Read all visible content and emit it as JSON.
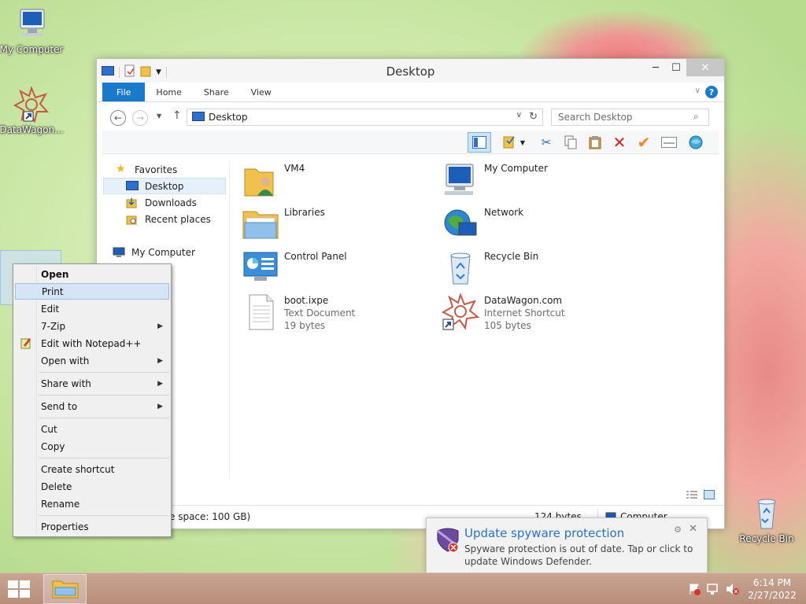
{
  "desktop": {
    "icons": [
      {
        "label": "My Computer"
      },
      {
        "label": "DataWagon..."
      },
      {
        "label": "Recycle Bin"
      }
    ]
  },
  "window": {
    "title": "Desktop",
    "ribbon_tabs": [
      "File",
      "Home",
      "Share",
      "View"
    ],
    "address": "Desktop",
    "search_placeholder": "Search Desktop",
    "nav": {
      "favorites": "Favorites",
      "items": [
        "Desktop",
        "Downloads",
        "Recent places"
      ],
      "computer": "My Computer"
    },
    "files": [
      {
        "name": "VM4",
        "type": "",
        "size": ""
      },
      {
        "name": "My Computer",
        "type": "",
        "size": ""
      },
      {
        "name": "Libraries",
        "type": "",
        "size": ""
      },
      {
        "name": "Network",
        "type": "",
        "size": ""
      },
      {
        "name": "Control Panel",
        "type": "",
        "size": ""
      },
      {
        "name": "Recycle Bin",
        "type": "",
        "size": ""
      },
      {
        "name": "boot.ixpe",
        "type": "Text Document",
        "size": "19 bytes"
      },
      {
        "name": "DataWagon.com",
        "type": "Internet Shortcut",
        "size": "105 bytes"
      }
    ],
    "status": {
      "free_space": "e space: 100 GB)",
      "size": "124 bytes",
      "location": "Computer"
    }
  },
  "context_menu": {
    "items": [
      "Open",
      "Print",
      "Edit",
      "7-Zip",
      "Edit with Notepad++",
      "Open with",
      "Share with",
      "Send to",
      "Cut",
      "Copy",
      "Create shortcut",
      "Delete",
      "Rename",
      "Properties"
    ],
    "highlighted": "Print"
  },
  "notification": {
    "title": "Update spyware protection",
    "body": "Spyware protection is out of date. Tap or click to update Windows Defender."
  },
  "taskbar": {
    "time": "6:14 PM",
    "date": "2/27/2022"
  },
  "colors": {
    "file_tab": "#1979ca",
    "notification_title": "#2a72c5",
    "menu_highlight": "#d5e5f6"
  }
}
